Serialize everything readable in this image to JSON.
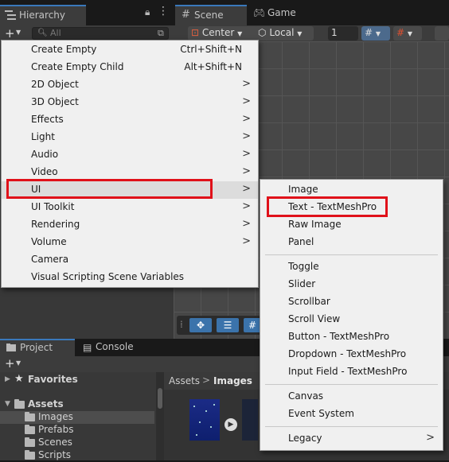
{
  "hierarchy": {
    "tab_label": "Hierarchy",
    "search_placeholder": "All",
    "icons": {
      "tab": "hierarchy-icon",
      "lock": "lock-icon",
      "menu": "kebab-menu-icon",
      "add": "plus-icon",
      "search": "search-icon",
      "scene_picker": "scene-picker-icon"
    }
  },
  "scene": {
    "tab_label": "Scene",
    "game_tab_label": "Game",
    "pivot_label": "Center",
    "space_label": "Local",
    "grid_snap_value": "1",
    "icons": {
      "scene_tab": "grid-icon",
      "game_tab": "gamepad-icon",
      "pivot": "pivot-icon",
      "space": "cube-icon",
      "snap": "grid-snap-icon",
      "increment": "increment-snap-icon",
      "move_tool": "move-tool-icon",
      "rect_tool": "rect-tool-icon"
    }
  },
  "project": {
    "tab_label": "Project",
    "console_tab_label": "Console",
    "tree": [
      {
        "label": "Favorites",
        "bold": true,
        "expanded": false,
        "icon": "star-icon"
      },
      {
        "label": "Assets",
        "bold": true,
        "expanded": true,
        "icon": "folder-icon"
      },
      {
        "label": "Images",
        "bold": false,
        "selected": true,
        "icon": "folder-icon"
      },
      {
        "label": "Prefabs",
        "bold": false,
        "icon": "folder-icon"
      },
      {
        "label": "Scenes",
        "bold": false,
        "icon": "folder-icon"
      },
      {
        "label": "Scripts",
        "bold": false,
        "icon": "folder-icon"
      }
    ],
    "breadcrumb": [
      "Assets",
      "Images"
    ],
    "breadcrumb_separator": ">"
  },
  "context_menu": {
    "items": [
      {
        "label": "Create Empty",
        "shortcut": "Ctrl+Shift+N",
        "submenu": false
      },
      {
        "label": "Create Empty Child",
        "shortcut": "Alt+Shift+N",
        "submenu": false
      },
      {
        "label": "2D Object",
        "submenu": true
      },
      {
        "label": "3D Object",
        "submenu": true
      },
      {
        "label": "Effects",
        "submenu": true
      },
      {
        "label": "Light",
        "submenu": true
      },
      {
        "label": "Audio",
        "submenu": true
      },
      {
        "label": "Video",
        "submenu": true
      },
      {
        "label": "UI",
        "submenu": true,
        "highlighted": true
      },
      {
        "label": "UI Toolkit",
        "submenu": true
      },
      {
        "label": "Rendering",
        "submenu": true
      },
      {
        "label": "Volume",
        "submenu": true
      },
      {
        "label": "Camera",
        "submenu": false
      },
      {
        "label": "Visual Scripting Scene Variables",
        "submenu": false
      }
    ],
    "submenu_arrow": ">"
  },
  "ui_submenu": {
    "groups": [
      [
        "Image",
        "Text - TextMeshPro",
        "Raw Image",
        "Panel"
      ],
      [
        "Toggle",
        "Slider",
        "Scrollbar",
        "Scroll View",
        "Button - TextMeshPro",
        "Dropdown - TextMeshPro",
        "Input Field - TextMeshPro"
      ],
      [
        "Canvas",
        "Event System"
      ],
      [
        "Legacy"
      ]
    ],
    "annotated_item": "Text - TextMeshPro"
  },
  "colors": {
    "annotation_red": "#e0111a",
    "accent_blue": "#3a79bb"
  }
}
